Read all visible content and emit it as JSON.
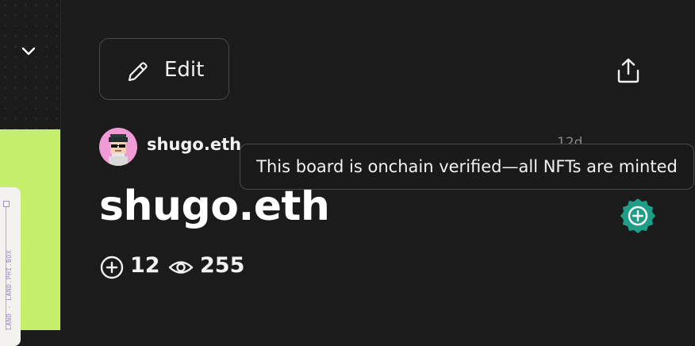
{
  "sidebar": {
    "collapse_icon": "chevron-down-icon",
    "canvas_label": "LAND - LAND.PHI.BOX"
  },
  "toolbar": {
    "edit_label": "Edit",
    "edit_icon": "pencil-icon",
    "share_icon": "share-icon"
  },
  "board": {
    "owner_name": "shugo.eth",
    "time_ago": "12d",
    "title": "shugo.eth",
    "tooltip": "This board is onchain verified—all NFTs are minted",
    "verified_icon": "verified-badge-icon",
    "stats": {
      "adds": "12",
      "views": "255"
    }
  },
  "colors": {
    "background": "#1b1b1b",
    "canvas_green": "#c5ee6a",
    "verified": "#1f9d86",
    "avatar_bg": "#f19bd6"
  }
}
